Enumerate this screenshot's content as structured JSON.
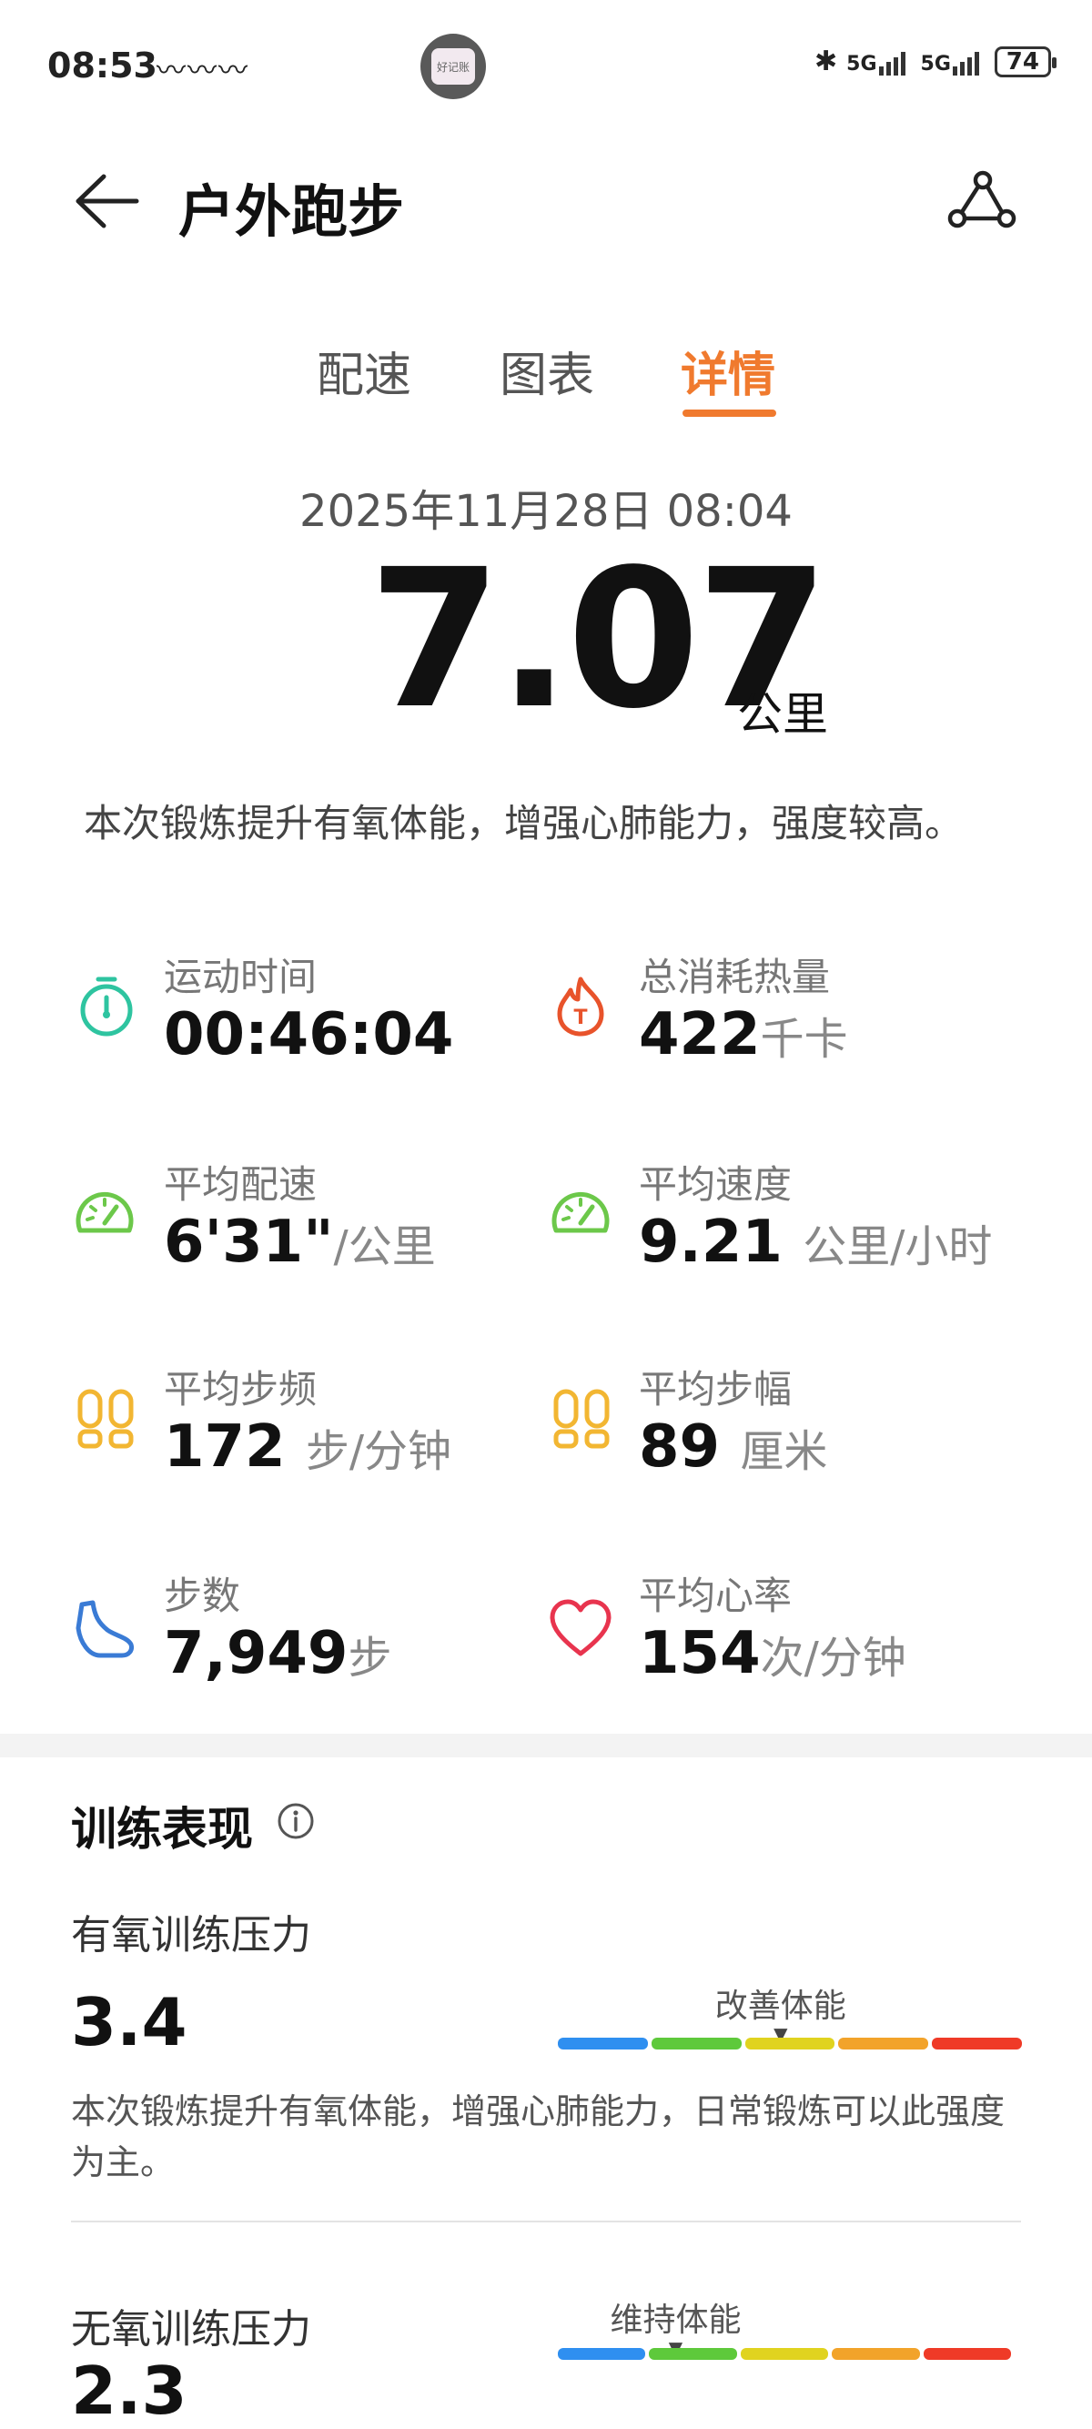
{
  "status_bar": {
    "time": "08:53",
    "net_icons": "〰〰〰",
    "app_icon_text": "好记账",
    "bluetooth": "✱",
    "signal_1": "5G",
    "signal_2": "5G",
    "battery": "74"
  },
  "header": {
    "title": "户外跑步"
  },
  "tabs": [
    {
      "label": "配速",
      "active": false
    },
    {
      "label": "图表",
      "active": false
    },
    {
      "label": "详情",
      "active": true
    }
  ],
  "workout": {
    "datetime": "2025年11月28日 08:04",
    "distance": "7.07",
    "distance_unit": "公里",
    "summary": "本次锻炼提升有氧体能，增强心肺能力，强度较高。"
  },
  "metrics": {
    "duration": {
      "label": "运动时间",
      "value": "00:46:04",
      "unit": "",
      "icon": "stopwatch-icon",
      "color": "#2ec4a0"
    },
    "calories": {
      "label": "总消耗热量",
      "value": "422",
      "unit": "千卡",
      "icon": "flame-icon",
      "color": "#e8532b"
    },
    "avg_pace": {
      "label": "平均配速",
      "value": "6'31\"",
      "unit": "/公里",
      "icon": "speedometer-icon",
      "color": "#6cc84a"
    },
    "avg_speed": {
      "label": "平均速度",
      "value": "9.21",
      "unit": "公里/小时",
      "icon": "speedometer-icon",
      "color": "#6cc84a"
    },
    "avg_cadence": {
      "label": "平均步频",
      "value": "172",
      "unit": "步/分钟",
      "icon": "footprints-icon",
      "color": "#f2b632"
    },
    "avg_stride": {
      "label": "平均步幅",
      "value": "89",
      "unit": "厘米",
      "icon": "footprints-icon",
      "color": "#f2b632"
    },
    "steps": {
      "label": "步数",
      "value": "7,949",
      "unit": "步",
      "icon": "shoe-icon",
      "color": "#3a7bd5"
    },
    "avg_heart_rate": {
      "label": "平均心率",
      "value": "154",
      "unit": "次/分钟",
      "icon": "heart-icon",
      "color": "#e8344e"
    }
  },
  "training": {
    "section_title": "训练表现",
    "aerobic": {
      "title": "有氧训练压力",
      "score": "3.4",
      "level_label": "改善体能",
      "level_fraction": 0.48,
      "description": "本次锻炼提升有氧体能，增强心肺能力，日常锻炼可以此强度为主。"
    },
    "anaerobic": {
      "title": "无氧训练压力",
      "score": "2.3",
      "level_label": "维持体能",
      "level_fraction": 0.26
    },
    "bar_colors": [
      "#2f8ff0",
      "#5ec93b",
      "#e0d31f",
      "#f2a32a",
      "#ef3a27"
    ]
  }
}
